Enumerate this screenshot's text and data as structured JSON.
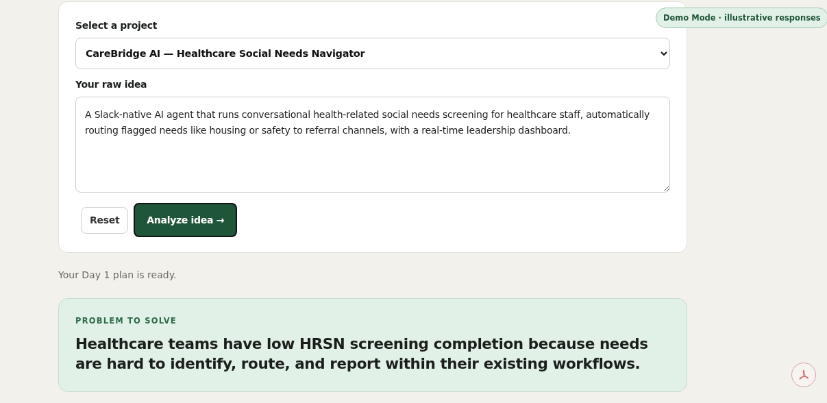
{
  "project_select": {
    "label": "Select a project",
    "value": "CareBridge AI — Healthcare Social Needs Navigator"
  },
  "raw_idea": {
    "label": "Your raw idea",
    "value": "A Slack-native AI agent that runs conversational health-related social needs screening for healthcare staff, automatically routing flagged needs like housing or safety to referral channels, with a real-time leadership dashboard."
  },
  "buttons": [
    {
      "label": "Reset",
      "kind": "secondary"
    },
    {
      "label": "Analyze idea →",
      "kind": "primary"
    }
  ],
  "status": "Your Day 1 plan is ready.",
  "problem": {
    "heading": "PROBLEM TO SOLVE",
    "text": "Healthcare teams have low HRSN screening completion because needs are hard to identify, route, and report within their existing workflows."
  },
  "demo_badge": "Demo Mode · illustrative responses"
}
